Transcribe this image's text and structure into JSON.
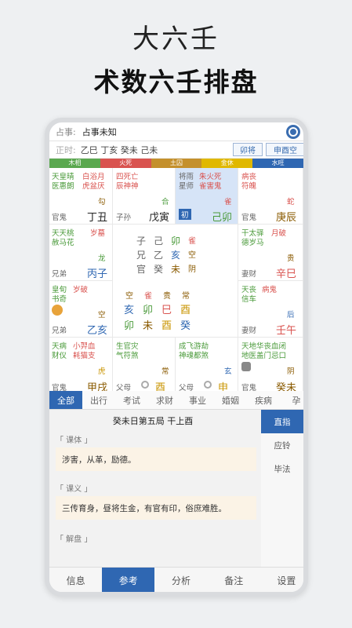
{
  "hero": {
    "line1": "大六壬",
    "line2": "术数六壬排盘"
  },
  "topbar": {
    "label": "占事:",
    "question": "占事未知"
  },
  "row2": {
    "label": "正时:",
    "ganzhi": "乙巳 丁亥 癸未 己未",
    "chip1": "卯将",
    "chip2": "申酉空"
  },
  "bars": [
    {
      "label": "木相",
      "color": "#5aa84f"
    },
    {
      "label": "火死",
      "color": "#d9534f"
    },
    {
      "label": "土囚",
      "color": "#c4902c"
    },
    {
      "label": "金休",
      "color": "#e0b800"
    },
    {
      "label": "水旺",
      "color": "#2f67b2"
    }
  ],
  "grid": {
    "c1": {
      "t1": "天皇晴",
      "t2": "医惠朗",
      "t3": "白浴月",
      "t4": "虎盆厌",
      "rel": "官鬼",
      "gz": "丁丑",
      "god": "勾"
    },
    "c2": {
      "t1": "四死亡",
      "t2": "辰神神",
      "rel": "子孙",
      "gz": "戊寅",
      "god": "合"
    },
    "c3": {
      "t1": "将雨",
      "t2": "星师",
      "t3": "朱火死",
      "t4": "雀害鬼",
      "rel": "初",
      "gz": "己卯",
      "god": "雀"
    },
    "c4": {
      "t1": "病丧",
      "t2": "符魄",
      "rel": "官鬼",
      "gz": "庚辰",
      "god": "蛇"
    },
    "c5": {
      "t1": "天天桃",
      "t2": "赦马花",
      "t3": "岁墓",
      "rel": "兄弟",
      "gz": "丙子",
      "god": "龙"
    },
    "c6": {
      "t1": "干太驿",
      "t2": "德岁马",
      "t3": "月破",
      "rel": "妻财",
      "gz": "辛巳",
      "god": "贵"
    },
    "c7": {
      "t1": "皇旬",
      "t2": "书奇",
      "t3": "岁破",
      "rel": "兄弟",
      "gz": "乙亥",
      "god": "空"
    },
    "c8": {
      "t1": "天丧",
      "t2": "信车",
      "t3": "病鬼",
      "rel": "妻财",
      "gz": "壬午",
      "god": "后"
    },
    "c9": {
      "t1": "天病",
      "t2": "财仪",
      "t3": "小羿血",
      "t4": "耗猫支",
      "rel": "官鬼",
      "gz": "甲戌",
      "god": "虎"
    },
    "c10": {
      "t1": "生官灾",
      "t2": "气符煞",
      "rel": "父母",
      "gz": "酉",
      "god": "常"
    },
    "c11": {
      "t1": "成飞游劫",
      "t2": "神魂都煞",
      "rel": "父母",
      "gz": "申",
      "god": "玄"
    },
    "c12": {
      "t1": "天地华丧血闭",
      "t2": "地医盖门忌口",
      "rel": "官鬼",
      "gz": "癸未",
      "god": "阴"
    },
    "center": {
      "s1": [
        "子",
        "己",
        "卯",
        "雀"
      ],
      "s2": [
        "兄",
        "乙",
        "亥",
        "空"
      ],
      "s3": [
        "官",
        "癸",
        "未",
        "阴"
      ],
      "k1": [
        "空",
        "雀",
        "贵",
        "常"
      ],
      "k2": [
        "亥",
        "卯",
        "巳",
        "酉"
      ],
      "k3": [
        "卯",
        "未",
        "酉",
        "癸"
      ]
    }
  },
  "tabs": [
    "全部",
    "出行",
    "考试",
    "求财",
    "事业",
    "婚姻",
    "疾病",
    "孕"
  ],
  "content": {
    "title": "癸未日第五局 干上酉",
    "s1": "「 课体 」",
    "b1": "涉害，从革，励德。",
    "s2": "「 课义 」",
    "b2": "三传育身，昼将生金，有官有印，俗庶难胜。",
    "s3": "「 解盘 」",
    "side": [
      "直指",
      "应铃",
      "毕法"
    ]
  },
  "nav": [
    "信息",
    "参考",
    "分析",
    "备注",
    "设置"
  ]
}
